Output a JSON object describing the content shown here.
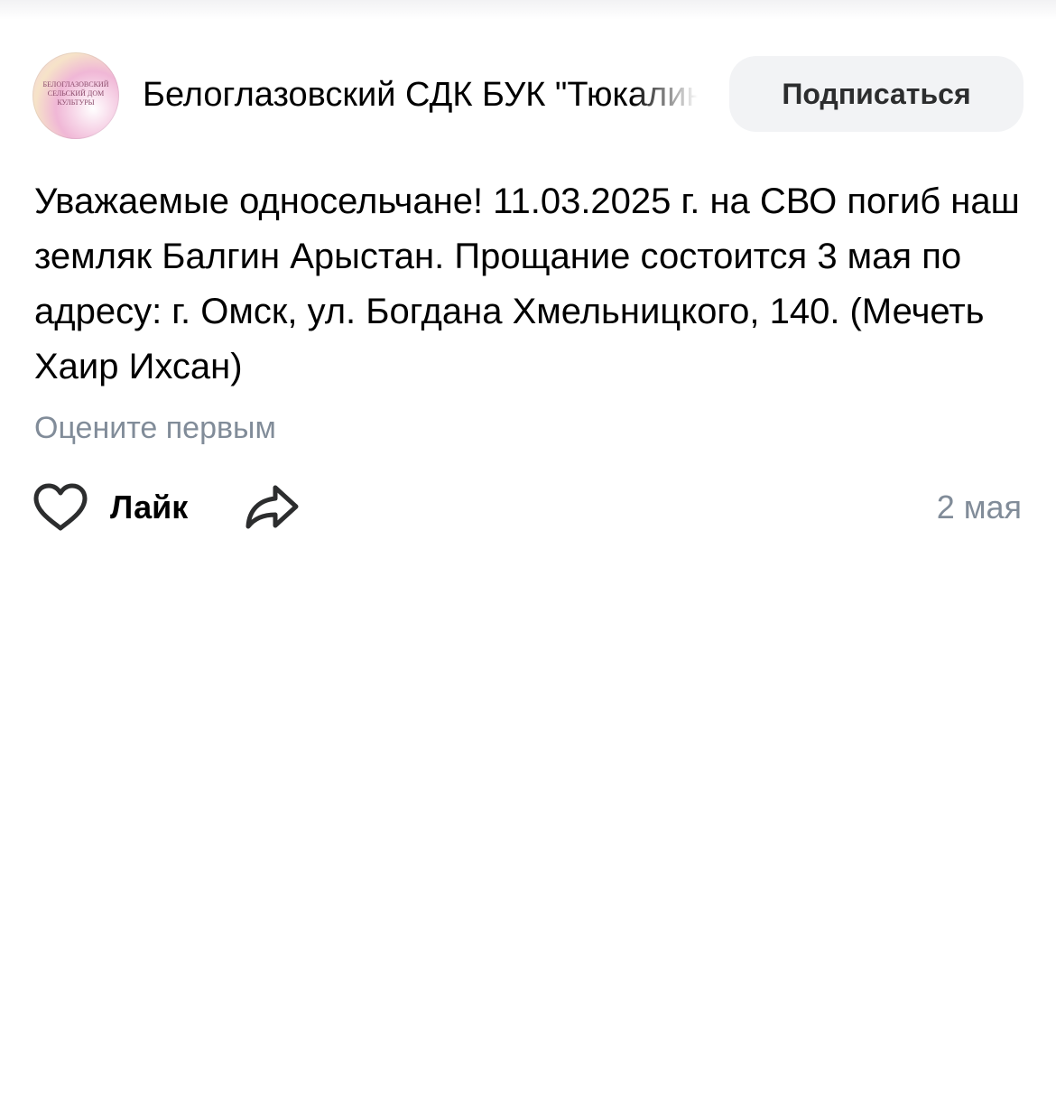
{
  "post": {
    "author": {
      "name": "Белоглазовский СДК БУК \"Тюкалинский районный центр культуры\"",
      "avatar_text": [
        "БЕЛОГЛАЗОВСКИЙ",
        "СЕЛЬСКИЙ ДОМ КУЛЬТУРЫ"
      ]
    },
    "subscribe_label": "Подписаться",
    "text": "Уважаемые односельчане! 11.03.2025 г. на СВО погиб наш земляк Балгин Арыстан. Прощание состоится 3 мая по адресу: г. Омск, ул. Богдана Хмельницкого, 140. (Мечеть Хаир Ихсан)",
    "rate_prompt": "Оцените первым",
    "like_label": "Лайк",
    "date": "2 мая"
  },
  "icons": {
    "like": "heart-outline-icon",
    "share": "share-arrow-icon"
  },
  "colors": {
    "secondary_text": "#818c99",
    "button_bg": "#f2f3f5",
    "button_text": "#2c2d2e",
    "icon_stroke": "#2c2d2e"
  }
}
